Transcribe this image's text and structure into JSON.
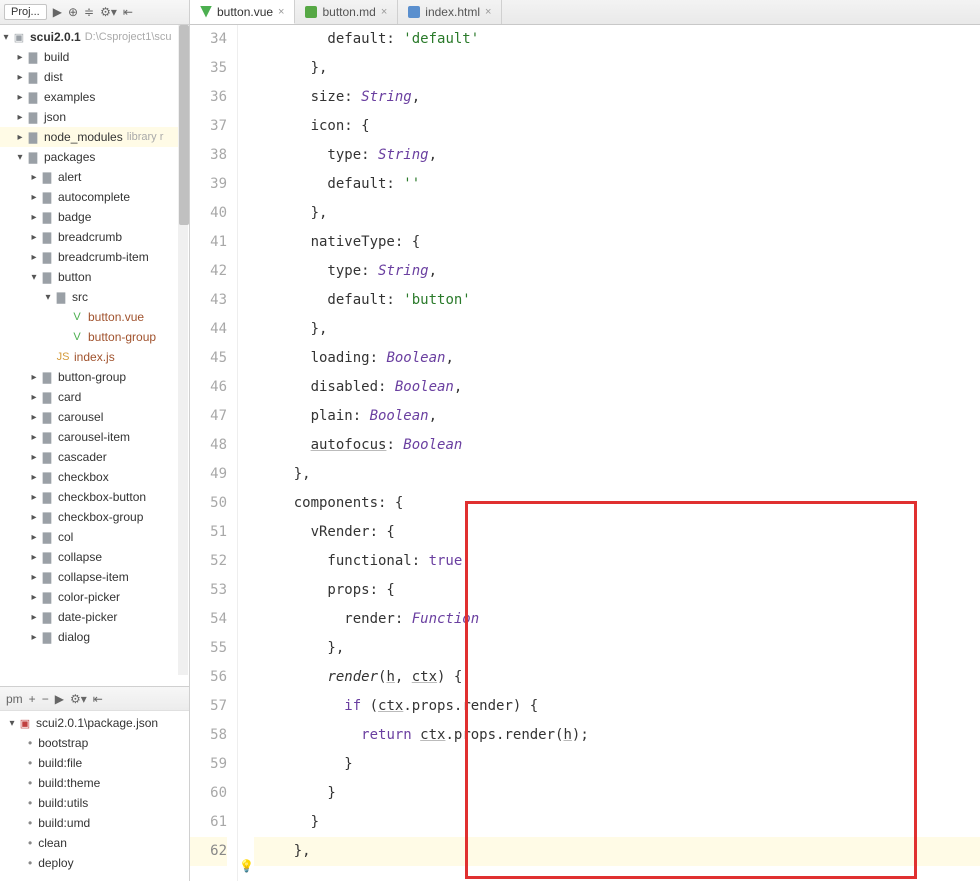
{
  "sidebar": {
    "projectTab": "Proj...",
    "root": {
      "name": "scui2.0.1",
      "path": "D:\\Csproject1\\scu"
    },
    "topFolders": [
      {
        "name": "build"
      },
      {
        "name": "dist"
      },
      {
        "name": "examples"
      },
      {
        "name": "json"
      },
      {
        "name": "node_modules",
        "hint": "library r",
        "highlight": true
      }
    ],
    "packages": {
      "name": "packages"
    },
    "packagesBefore": [
      "alert",
      "autocomplete",
      "badge",
      "breadcrumb",
      "breadcrumb-item"
    ],
    "button": {
      "name": "button",
      "src": "src",
      "files": [
        "button.vue",
        "button-group"
      ],
      "indexjs": "index.js"
    },
    "packagesAfter": [
      "button-group",
      "card",
      "carousel",
      "carousel-item",
      "cascader",
      "checkbox",
      "checkbox-button",
      "checkbox-group",
      "col",
      "collapse",
      "collapse-item",
      "color-picker",
      "date-picker",
      "dialog"
    ]
  },
  "npm": {
    "label": "pm",
    "package": "scui2.0.1\\package.json",
    "scripts": [
      "bootstrap",
      "build:file",
      "build:theme",
      "build:utils",
      "build:umd",
      "clean",
      "deploy"
    ]
  },
  "tabs": [
    {
      "label": "button.vue"
    },
    {
      "label": "button.md"
    },
    {
      "label": "index.html"
    }
  ],
  "editor": {
    "startLine": 34,
    "highlightLine": 62,
    "lines": [
      [
        [
          "        default: "
        ],
        [
          "str",
          "'default'"
        ]
      ],
      [
        [
          "      },"
        ]
      ],
      [
        [
          "      size: "
        ],
        [
          "typ",
          "String"
        ],
        [
          ","
        ]
      ],
      [
        [
          "      icon: {"
        ]
      ],
      [
        [
          "        type: "
        ],
        [
          "typ",
          "String"
        ],
        [
          ","
        ]
      ],
      [
        [
          "        default: "
        ],
        [
          "str",
          "''"
        ]
      ],
      [
        [
          "      },"
        ]
      ],
      [
        [
          "      nativeType: {"
        ]
      ],
      [
        [
          "        type: "
        ],
        [
          "typ",
          "String"
        ],
        [
          ","
        ]
      ],
      [
        [
          "        default: "
        ],
        [
          "str",
          "'button'"
        ]
      ],
      [
        [
          "      },"
        ]
      ],
      [
        [
          "      loading: "
        ],
        [
          "typ",
          "Boolean"
        ],
        [
          ","
        ]
      ],
      [
        [
          "      disabled: "
        ],
        [
          "typ",
          "Boolean"
        ],
        [
          ","
        ]
      ],
      [
        [
          "      plain: "
        ],
        [
          "typ",
          "Boolean"
        ],
        [
          ","
        ]
      ],
      [
        [
          "      "
        ],
        [
          "ul",
          "autofocus"
        ],
        [
          ": "
        ],
        [
          "typ",
          "Boolean"
        ]
      ],
      [
        [
          "    },"
        ]
      ],
      [
        [
          "    components: {"
        ]
      ],
      [
        [
          "      vRender: {"
        ]
      ],
      [
        [
          "        functional: "
        ],
        [
          "kw",
          "true"
        ],
        [
          ","
        ]
      ],
      [
        [
          "        props: {"
        ]
      ],
      [
        [
          "          render: "
        ],
        [
          "typ",
          "Function"
        ]
      ],
      [
        [
          "        },"
        ]
      ],
      [
        [
          "        "
        ],
        [
          "ital",
          "render"
        ],
        [
          "("
        ],
        [
          "ul",
          "h"
        ],
        [
          ", "
        ],
        [
          "ul",
          "ctx"
        ],
        [
          ") {"
        ]
      ],
      [
        [
          "          "
        ],
        [
          "kw",
          "if "
        ],
        [
          "("
        ],
        [
          "ul",
          "ctx"
        ],
        [
          ".props.render) {"
        ]
      ],
      [
        [
          "            "
        ],
        [
          "kw",
          "return "
        ],
        [
          "ul",
          "ctx"
        ],
        [
          ".props.render("
        ],
        [
          "ul",
          "h"
        ],
        [
          ");"
        ]
      ],
      [
        [
          "          }"
        ]
      ],
      [
        [
          "        }"
        ]
      ],
      [
        [
          "      }"
        ]
      ],
      [
        [
          "    },"
        ]
      ]
    ]
  }
}
